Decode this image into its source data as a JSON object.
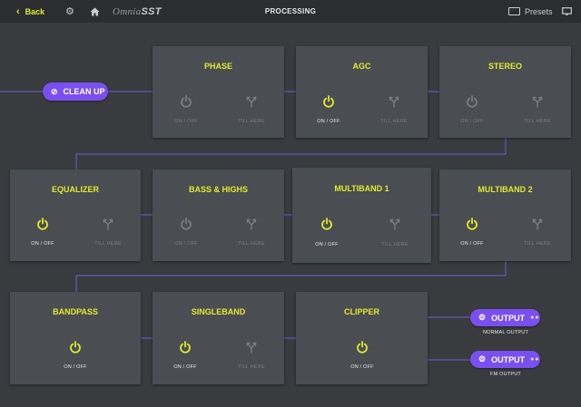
{
  "topbar": {
    "back_label": "Back",
    "logo_prefix": "Omnia",
    "logo_suffix": "SST",
    "title": "PROCESSING",
    "presets_label": "Presets"
  },
  "cleanup_label": "CLEAN UP",
  "blocks": {
    "phase": {
      "name": "PHASE",
      "power_label": "ON / OFF",
      "till_label": "TILL HERE",
      "enabled": false
    },
    "agc": {
      "name": "AGC",
      "power_label": "ON / OFF",
      "till_label": "TILL HERE",
      "enabled": true
    },
    "stereo": {
      "name": "STEREO",
      "power_label": "ON / OFF",
      "till_label": "TILL HERE",
      "enabled": false
    },
    "equalizer": {
      "name": "EQUALIZER",
      "power_label": "ON / OFF",
      "till_label": "TILL HERE",
      "enabled": true
    },
    "bass_highs": {
      "name": "BASS & HIGHS",
      "power_label": "ON / OFF",
      "till_label": "TILL HERE",
      "enabled": false
    },
    "multiband1": {
      "name": "MULTIBAND 1",
      "power_label": "ON / OFF",
      "till_label": "TILL HERE",
      "enabled": true
    },
    "multiband2": {
      "name": "MULTIBAND 2",
      "power_label": "ON / OFF",
      "till_label": "TILL HERE",
      "enabled": true
    },
    "bandpass": {
      "name": "BANDPASS",
      "power_label": "ON / OFF",
      "enabled": true
    },
    "singleband": {
      "name": "SINGLEBAND",
      "power_label": "ON / OFF",
      "till_label": "TILL HERE",
      "enabled": true
    },
    "clipper": {
      "name": "CLIPPER",
      "power_label": "ON / OFF",
      "enabled": true
    }
  },
  "outputs": [
    {
      "label": "OUTPUT",
      "caption": "NORMAL OUTPUT"
    },
    {
      "label": "OUTPUT",
      "caption": "FM OUTPUT"
    }
  ],
  "colors": {
    "accent": "#e2ea2c",
    "pill": "#7a4ff0",
    "line": "#6a5fd8",
    "disabled": "#7a7d81"
  }
}
